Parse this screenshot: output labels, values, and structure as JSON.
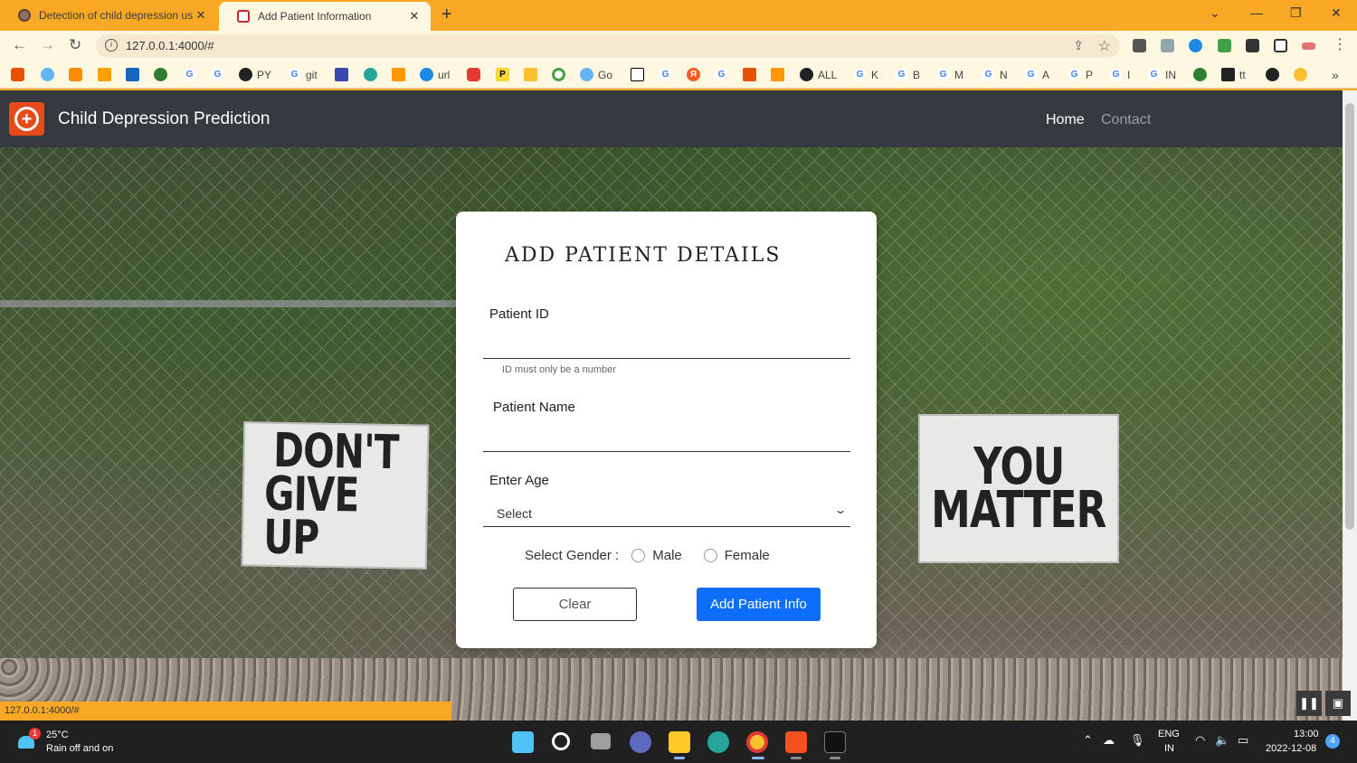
{
  "browser": {
    "tabs": [
      {
        "title": "Detection of child depression us",
        "active": false
      },
      {
        "title": "Add Patient Information",
        "active": true
      }
    ],
    "url": "127.0.0.1:4000/#",
    "status_url": "127.0.0.1:4000/#",
    "bookmarks": [
      {
        "label": "PY"
      },
      {
        "label": "git"
      },
      {
        "label": "url"
      },
      {
        "label": "Go"
      },
      {
        "label": "ALL"
      },
      {
        "label": "K"
      },
      {
        "label": "B"
      },
      {
        "label": "M"
      },
      {
        "label": "N"
      },
      {
        "label": "A"
      },
      {
        "label": "P"
      },
      {
        "label": "I"
      },
      {
        "label": "IN"
      },
      {
        "label": "tt"
      }
    ],
    "overflow_icon": "»"
  },
  "navbar": {
    "brand": "Child Depression Prediction",
    "links": {
      "home": "Home",
      "contact": "Contact"
    }
  },
  "background": {
    "sign_left": [
      "DON'T",
      "GIVE UP"
    ],
    "sign_right": [
      "YOU",
      "MATTER"
    ]
  },
  "form": {
    "title": "ADD PATIENT DETAILS",
    "patient_id": {
      "label": "Patient ID",
      "value": "",
      "hint": "ID must only be a number"
    },
    "patient_name": {
      "label": "Patient Name",
      "value": ""
    },
    "age": {
      "label": "Enter Age",
      "selected": "Select"
    },
    "gender": {
      "label": "Select Gender :",
      "options": [
        "Male",
        "Female"
      ]
    },
    "buttons": {
      "clear": "Clear",
      "submit": "Add Patient Info"
    },
    "colors": {
      "submit_bg": "#0d6efd",
      "navbar_bg": "#343a40"
    }
  },
  "taskbar": {
    "weather": {
      "badge": "1",
      "temp": "25°C",
      "desc": "Rain off and on"
    },
    "language": {
      "lang": "ENG",
      "region": "IN"
    },
    "clock": {
      "time": "13:00",
      "date": "2022-12-08"
    },
    "notification_count": "4"
  }
}
